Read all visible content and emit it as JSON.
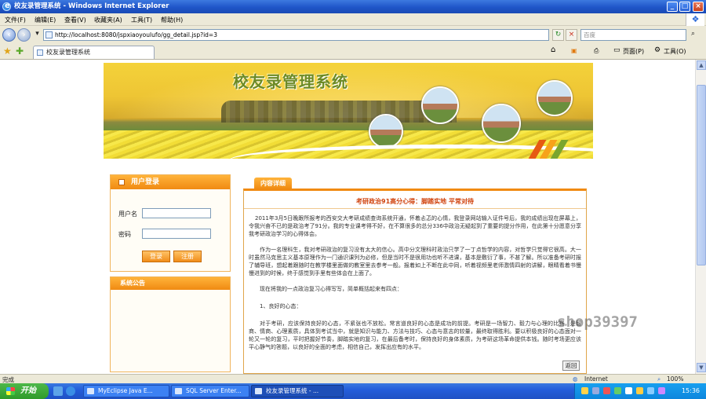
{
  "window": {
    "title": "校友录管理系统 - Windows Internet Explorer"
  },
  "menubar": {
    "items": [
      "文件(F)",
      "编辑(E)",
      "查看(V)",
      "收藏夹(A)",
      "工具(T)",
      "帮助(H)"
    ]
  },
  "addressbar": {
    "url": "http://localhost:8080/jspxiaoyoulufo/gg_detail.jsp?id=3",
    "search_placeholder": "百度"
  },
  "tab": {
    "label": "校友录管理系统"
  },
  "tab_tools": {
    "page_label": "页面(P)",
    "tools_label": "工具(O)"
  },
  "site": {
    "banner_title": "校友录管理系统",
    "login": {
      "header": "用户登录",
      "username_label": "用户名",
      "password_label": "密码",
      "login_button": "登录",
      "register_button": "注册"
    },
    "notice": {
      "header": "系统公告"
    },
    "content": {
      "tab_label": "内容详细",
      "title": "考研政治91高分心得：脚踏实地 平常对待",
      "paragraphs": [
        "2011年3月5日晚跟所报考的西安交大考研成绩查询系统开通，怀着忐忑的心情，我登录网站输入证件号后，我的成绩出现在屏幕上，令我兴奋不已的是政治考了91分。我的专业课考得不好，在不算很多的总分336中政治无疑起到了重要的提分作用，在此第十分愿意分享我考研政治学习的心得体会。",
        "作为一名理科生，我对考研政治的复习没有太大的信心。高中分文理科时政治只学了一丁点哲学的内容，对哲学只觉得它很高。大一时虽然马克思主义基本原理作为一门通识课列为必修，但是当时不是很用功也听不进课，基本是敷衍了事，不甚了解。所以准备考研时报了辅导班，想起着跟随时在教学楼里面做的教室里去参考一般。报着如上不断在此中同，听着视频里老师激情四射的讲解，眼睛看着书慢慢进到的时候，终于感觉到手里有些体会在上面了。",
        "现在将我的一点政治复习心得写写，简单概括起来有四点：",
        "1、良好的心态：",
        "对于考研，应该保持良好的心态，不紧张也不放松。常言道良好的心态是成功的前提。考研是一场智力、毅力与心理的比赛，是智商、情商、心理素质，具体到考试当中，就是知识与能力、方法与技巧、心态与意志的较量，最终取得胜利。要以积极良好的心态面对一轮又一轮的复习，平时把握好节奏，脚踏实地的复习，在最后备考时，保持良好的身体素质，为考研这场革命提供本钱。随时考场更应该平心静气的答题，以良好的全面的考虑，相信自己，发挥出应有的水平。"
      ],
      "back_button": "返回"
    },
    "watermark": "shop39397"
  },
  "statusbar": {
    "left_text": "完成",
    "zone": "Internet",
    "zoom": "100%"
  },
  "taskbar": {
    "start_label": "开始",
    "tasks": [
      "MyEclipse Java E...",
      "SQL Server Enter...",
      "校友录管理系统 - ..."
    ],
    "clock": "15:36"
  },
  "colors": {
    "accent_orange": "#f08a12",
    "title_red": "#d0420d",
    "banner_green_text": "#6c8a25",
    "xp_blue": "#245edb"
  }
}
